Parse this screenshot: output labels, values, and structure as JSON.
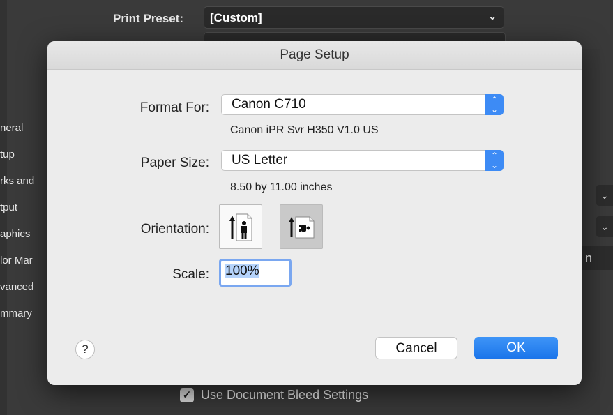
{
  "background": {
    "print_preset_label": "Print Preset:",
    "print_preset_value": "[Custom]",
    "sidebar_items": [
      "neral",
      "tup",
      "rks and",
      "tput",
      "aphics",
      "lor Mar",
      "vanced",
      "mmary"
    ],
    "right_fragment": "n",
    "bleed_label": "Use Document Bleed Settings"
  },
  "dialog": {
    "title": "Page Setup",
    "format_for_label": "Format For:",
    "format_for_value": "Canon C710",
    "format_for_sub": "Canon iPR Svr H350 V1.0 US",
    "paper_size_label": "Paper Size:",
    "paper_size_value": "US Letter",
    "paper_size_sub": "8.50 by 11.00 inches",
    "orientation_label": "Orientation:",
    "orientation_selected": "portrait",
    "scale_label": "Scale:",
    "scale_value": "100%",
    "help_label": "?",
    "cancel_label": "Cancel",
    "ok_label": "OK"
  },
  "colors": {
    "accent": "#1a74ea",
    "background_dark": "#3a3a3a",
    "dialog_bg": "#ececec"
  }
}
